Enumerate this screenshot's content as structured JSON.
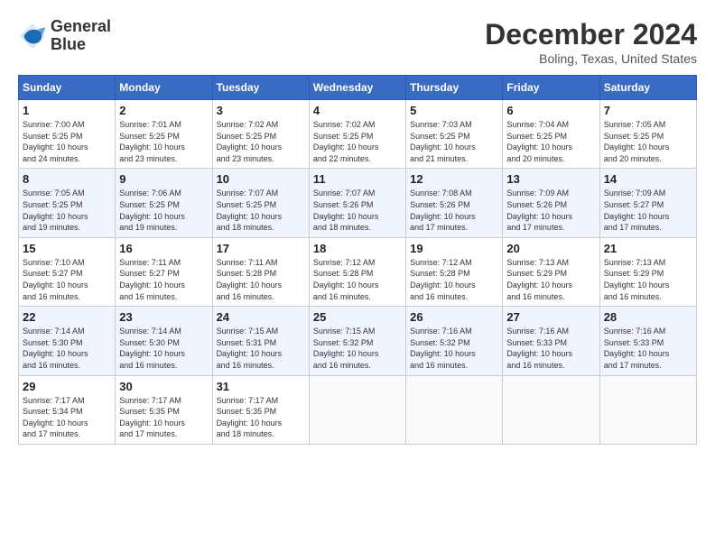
{
  "header": {
    "logo_line1": "General",
    "logo_line2": "Blue",
    "month": "December 2024",
    "location": "Boling, Texas, United States"
  },
  "days_of_week": [
    "Sunday",
    "Monday",
    "Tuesday",
    "Wednesday",
    "Thursday",
    "Friday",
    "Saturday"
  ],
  "weeks": [
    [
      {
        "day": "1",
        "info": "Sunrise: 7:00 AM\nSunset: 5:25 PM\nDaylight: 10 hours\nand 24 minutes."
      },
      {
        "day": "2",
        "info": "Sunrise: 7:01 AM\nSunset: 5:25 PM\nDaylight: 10 hours\nand 23 minutes."
      },
      {
        "day": "3",
        "info": "Sunrise: 7:02 AM\nSunset: 5:25 PM\nDaylight: 10 hours\nand 23 minutes."
      },
      {
        "day": "4",
        "info": "Sunrise: 7:02 AM\nSunset: 5:25 PM\nDaylight: 10 hours\nand 22 minutes."
      },
      {
        "day": "5",
        "info": "Sunrise: 7:03 AM\nSunset: 5:25 PM\nDaylight: 10 hours\nand 21 minutes."
      },
      {
        "day": "6",
        "info": "Sunrise: 7:04 AM\nSunset: 5:25 PM\nDaylight: 10 hours\nand 20 minutes."
      },
      {
        "day": "7",
        "info": "Sunrise: 7:05 AM\nSunset: 5:25 PM\nDaylight: 10 hours\nand 20 minutes."
      }
    ],
    [
      {
        "day": "8",
        "info": "Sunrise: 7:05 AM\nSunset: 5:25 PM\nDaylight: 10 hours\nand 19 minutes."
      },
      {
        "day": "9",
        "info": "Sunrise: 7:06 AM\nSunset: 5:25 PM\nDaylight: 10 hours\nand 19 minutes."
      },
      {
        "day": "10",
        "info": "Sunrise: 7:07 AM\nSunset: 5:25 PM\nDaylight: 10 hours\nand 18 minutes."
      },
      {
        "day": "11",
        "info": "Sunrise: 7:07 AM\nSunset: 5:26 PM\nDaylight: 10 hours\nand 18 minutes."
      },
      {
        "day": "12",
        "info": "Sunrise: 7:08 AM\nSunset: 5:26 PM\nDaylight: 10 hours\nand 17 minutes."
      },
      {
        "day": "13",
        "info": "Sunrise: 7:09 AM\nSunset: 5:26 PM\nDaylight: 10 hours\nand 17 minutes."
      },
      {
        "day": "14",
        "info": "Sunrise: 7:09 AM\nSunset: 5:27 PM\nDaylight: 10 hours\nand 17 minutes."
      }
    ],
    [
      {
        "day": "15",
        "info": "Sunrise: 7:10 AM\nSunset: 5:27 PM\nDaylight: 10 hours\nand 16 minutes."
      },
      {
        "day": "16",
        "info": "Sunrise: 7:11 AM\nSunset: 5:27 PM\nDaylight: 10 hours\nand 16 minutes."
      },
      {
        "day": "17",
        "info": "Sunrise: 7:11 AM\nSunset: 5:28 PM\nDaylight: 10 hours\nand 16 minutes."
      },
      {
        "day": "18",
        "info": "Sunrise: 7:12 AM\nSunset: 5:28 PM\nDaylight: 10 hours\nand 16 minutes."
      },
      {
        "day": "19",
        "info": "Sunrise: 7:12 AM\nSunset: 5:28 PM\nDaylight: 10 hours\nand 16 minutes."
      },
      {
        "day": "20",
        "info": "Sunrise: 7:13 AM\nSunset: 5:29 PM\nDaylight: 10 hours\nand 16 minutes."
      },
      {
        "day": "21",
        "info": "Sunrise: 7:13 AM\nSunset: 5:29 PM\nDaylight: 10 hours\nand 16 minutes."
      }
    ],
    [
      {
        "day": "22",
        "info": "Sunrise: 7:14 AM\nSunset: 5:30 PM\nDaylight: 10 hours\nand 16 minutes."
      },
      {
        "day": "23",
        "info": "Sunrise: 7:14 AM\nSunset: 5:30 PM\nDaylight: 10 hours\nand 16 minutes."
      },
      {
        "day": "24",
        "info": "Sunrise: 7:15 AM\nSunset: 5:31 PM\nDaylight: 10 hours\nand 16 minutes."
      },
      {
        "day": "25",
        "info": "Sunrise: 7:15 AM\nSunset: 5:32 PM\nDaylight: 10 hours\nand 16 minutes."
      },
      {
        "day": "26",
        "info": "Sunrise: 7:16 AM\nSunset: 5:32 PM\nDaylight: 10 hours\nand 16 minutes."
      },
      {
        "day": "27",
        "info": "Sunrise: 7:16 AM\nSunset: 5:33 PM\nDaylight: 10 hours\nand 16 minutes."
      },
      {
        "day": "28",
        "info": "Sunrise: 7:16 AM\nSunset: 5:33 PM\nDaylight: 10 hours\nand 17 minutes."
      }
    ],
    [
      {
        "day": "29",
        "info": "Sunrise: 7:17 AM\nSunset: 5:34 PM\nDaylight: 10 hours\nand 17 minutes."
      },
      {
        "day": "30",
        "info": "Sunrise: 7:17 AM\nSunset: 5:35 PM\nDaylight: 10 hours\nand 17 minutes."
      },
      {
        "day": "31",
        "info": "Sunrise: 7:17 AM\nSunset: 5:35 PM\nDaylight: 10 hours\nand 18 minutes."
      },
      {
        "day": "",
        "info": ""
      },
      {
        "day": "",
        "info": ""
      },
      {
        "day": "",
        "info": ""
      },
      {
        "day": "",
        "info": ""
      }
    ]
  ]
}
